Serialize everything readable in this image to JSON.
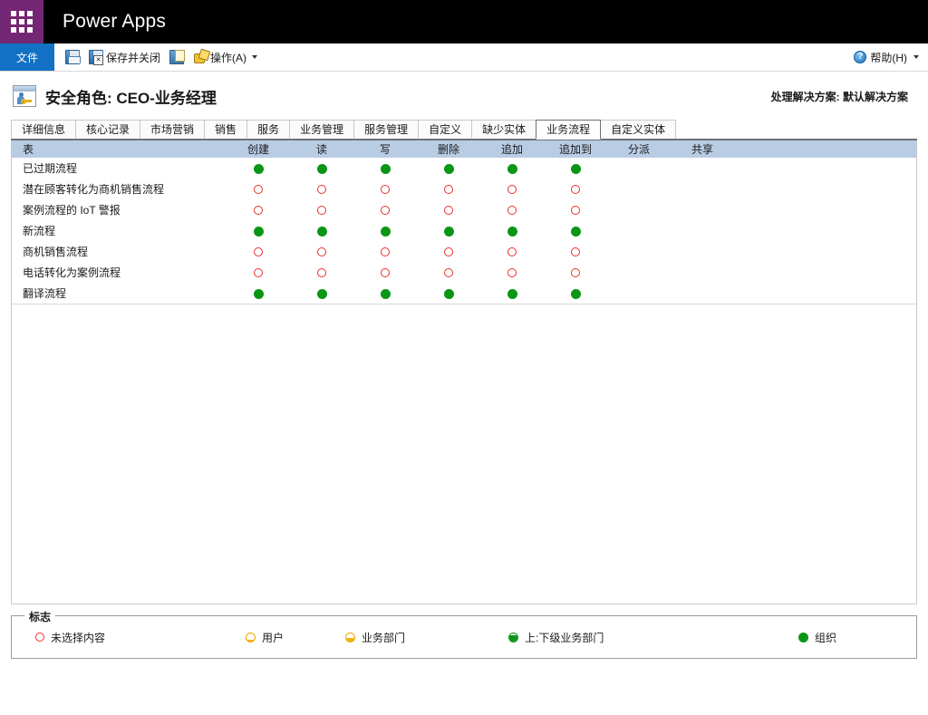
{
  "suite": {
    "waffle_icon": "waffle-grid-icon",
    "title": "Power Apps"
  },
  "ribbon": {
    "file_label": "文件",
    "commands": [
      {
        "icon": "save-icon",
        "label": ""
      },
      {
        "icon": "save-and-close-icon",
        "label": "保存并关闭"
      },
      {
        "icon": "new-record-icon",
        "label": ""
      },
      {
        "icon": "actions-icon",
        "label": "操作(A)",
        "has_caret": true
      }
    ],
    "help": {
      "icon": "help-icon",
      "label": "帮助(H)",
      "has_caret": true
    }
  },
  "form": {
    "icon": "security-role-icon",
    "title": "安全角色: CEO-业务经理",
    "solution_note": "处理解决方案: 默认解决方案"
  },
  "tabs": [
    {
      "label": "详细信息",
      "active": false
    },
    {
      "label": "核心记录",
      "active": false
    },
    {
      "label": "市场营销",
      "active": false
    },
    {
      "label": "销售",
      "active": false
    },
    {
      "label": "服务",
      "active": false
    },
    {
      "label": "业务管理",
      "active": false
    },
    {
      "label": "服务管理",
      "active": false
    },
    {
      "label": "自定义",
      "active": false
    },
    {
      "label": "缺少实体",
      "active": false
    },
    {
      "label": "业务流程",
      "active": true
    },
    {
      "label": "自定义实体",
      "active": false
    }
  ],
  "table": {
    "columns": [
      "表",
      "创建",
      "读",
      "写",
      "删除",
      "追加",
      "追加到",
      "分派",
      "共享"
    ],
    "rows": [
      {
        "name": "已过期流程",
        "privs": [
          "org",
          "org",
          "org",
          "org",
          "org",
          "org",
          "",
          ""
        ]
      },
      {
        "name": "潜在顾客转化为商机销售流程",
        "privs": [
          "none",
          "none",
          "none",
          "none",
          "none",
          "none",
          "",
          ""
        ]
      },
      {
        "name": "案例流程的 IoT 警报",
        "privs": [
          "none",
          "none",
          "none",
          "none",
          "none",
          "none",
          "",
          ""
        ]
      },
      {
        "name": "新流程",
        "privs": [
          "org",
          "org",
          "org",
          "org",
          "org",
          "org",
          "",
          ""
        ]
      },
      {
        "name": "商机销售流程",
        "privs": [
          "none",
          "none",
          "none",
          "none",
          "none",
          "none",
          "",
          ""
        ]
      },
      {
        "name": "电话转化为案例流程",
        "privs": [
          "none",
          "none",
          "none",
          "none",
          "none",
          "none",
          "",
          ""
        ]
      },
      {
        "name": "翻译流程",
        "privs": [
          "org",
          "org",
          "org",
          "org",
          "org",
          "org",
          "",
          ""
        ]
      }
    ]
  },
  "legend": {
    "title": "标志",
    "items": [
      {
        "state": "none",
        "label": "未选择内容"
      },
      {
        "state": "user",
        "label": "用户"
      },
      {
        "state": "bu",
        "label": "业务部门"
      },
      {
        "state": "pcbu",
        "label": "上:下级业务部门"
      },
      {
        "state": "org",
        "label": "组织"
      }
    ]
  },
  "colors": {
    "waffle_purple": "#742774",
    "suite_black": "#000000",
    "file_blue": "#1271c4",
    "table_header_blue": "#b8cce4",
    "privilege_green": "#0a9615",
    "privilege_red": "#e8302a",
    "privilege_amber": "#f3b300"
  }
}
